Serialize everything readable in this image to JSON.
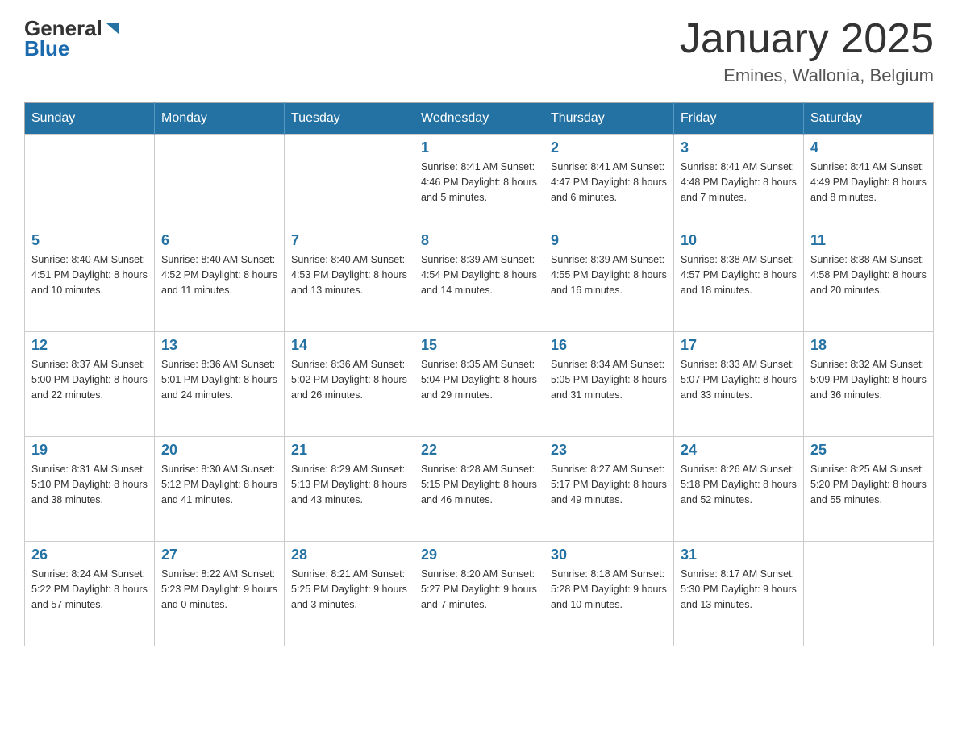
{
  "logo": {
    "general": "General",
    "blue": "Blue"
  },
  "header": {
    "month": "January 2025",
    "location": "Emines, Wallonia, Belgium"
  },
  "weekdays": [
    "Sunday",
    "Monday",
    "Tuesday",
    "Wednesday",
    "Thursday",
    "Friday",
    "Saturday"
  ],
  "weeks": [
    [
      {
        "day": "",
        "info": ""
      },
      {
        "day": "",
        "info": ""
      },
      {
        "day": "",
        "info": ""
      },
      {
        "day": "1",
        "info": "Sunrise: 8:41 AM\nSunset: 4:46 PM\nDaylight: 8 hours\nand 5 minutes."
      },
      {
        "day": "2",
        "info": "Sunrise: 8:41 AM\nSunset: 4:47 PM\nDaylight: 8 hours\nand 6 minutes."
      },
      {
        "day": "3",
        "info": "Sunrise: 8:41 AM\nSunset: 4:48 PM\nDaylight: 8 hours\nand 7 minutes."
      },
      {
        "day": "4",
        "info": "Sunrise: 8:41 AM\nSunset: 4:49 PM\nDaylight: 8 hours\nand 8 minutes."
      }
    ],
    [
      {
        "day": "5",
        "info": "Sunrise: 8:40 AM\nSunset: 4:51 PM\nDaylight: 8 hours\nand 10 minutes."
      },
      {
        "day": "6",
        "info": "Sunrise: 8:40 AM\nSunset: 4:52 PM\nDaylight: 8 hours\nand 11 minutes."
      },
      {
        "day": "7",
        "info": "Sunrise: 8:40 AM\nSunset: 4:53 PM\nDaylight: 8 hours\nand 13 minutes."
      },
      {
        "day": "8",
        "info": "Sunrise: 8:39 AM\nSunset: 4:54 PM\nDaylight: 8 hours\nand 14 minutes."
      },
      {
        "day": "9",
        "info": "Sunrise: 8:39 AM\nSunset: 4:55 PM\nDaylight: 8 hours\nand 16 minutes."
      },
      {
        "day": "10",
        "info": "Sunrise: 8:38 AM\nSunset: 4:57 PM\nDaylight: 8 hours\nand 18 minutes."
      },
      {
        "day": "11",
        "info": "Sunrise: 8:38 AM\nSunset: 4:58 PM\nDaylight: 8 hours\nand 20 minutes."
      }
    ],
    [
      {
        "day": "12",
        "info": "Sunrise: 8:37 AM\nSunset: 5:00 PM\nDaylight: 8 hours\nand 22 minutes."
      },
      {
        "day": "13",
        "info": "Sunrise: 8:36 AM\nSunset: 5:01 PM\nDaylight: 8 hours\nand 24 minutes."
      },
      {
        "day": "14",
        "info": "Sunrise: 8:36 AM\nSunset: 5:02 PM\nDaylight: 8 hours\nand 26 minutes."
      },
      {
        "day": "15",
        "info": "Sunrise: 8:35 AM\nSunset: 5:04 PM\nDaylight: 8 hours\nand 29 minutes."
      },
      {
        "day": "16",
        "info": "Sunrise: 8:34 AM\nSunset: 5:05 PM\nDaylight: 8 hours\nand 31 minutes."
      },
      {
        "day": "17",
        "info": "Sunrise: 8:33 AM\nSunset: 5:07 PM\nDaylight: 8 hours\nand 33 minutes."
      },
      {
        "day": "18",
        "info": "Sunrise: 8:32 AM\nSunset: 5:09 PM\nDaylight: 8 hours\nand 36 minutes."
      }
    ],
    [
      {
        "day": "19",
        "info": "Sunrise: 8:31 AM\nSunset: 5:10 PM\nDaylight: 8 hours\nand 38 minutes."
      },
      {
        "day": "20",
        "info": "Sunrise: 8:30 AM\nSunset: 5:12 PM\nDaylight: 8 hours\nand 41 minutes."
      },
      {
        "day": "21",
        "info": "Sunrise: 8:29 AM\nSunset: 5:13 PM\nDaylight: 8 hours\nand 43 minutes."
      },
      {
        "day": "22",
        "info": "Sunrise: 8:28 AM\nSunset: 5:15 PM\nDaylight: 8 hours\nand 46 minutes."
      },
      {
        "day": "23",
        "info": "Sunrise: 8:27 AM\nSunset: 5:17 PM\nDaylight: 8 hours\nand 49 minutes."
      },
      {
        "day": "24",
        "info": "Sunrise: 8:26 AM\nSunset: 5:18 PM\nDaylight: 8 hours\nand 52 minutes."
      },
      {
        "day": "25",
        "info": "Sunrise: 8:25 AM\nSunset: 5:20 PM\nDaylight: 8 hours\nand 55 minutes."
      }
    ],
    [
      {
        "day": "26",
        "info": "Sunrise: 8:24 AM\nSunset: 5:22 PM\nDaylight: 8 hours\nand 57 minutes."
      },
      {
        "day": "27",
        "info": "Sunrise: 8:22 AM\nSunset: 5:23 PM\nDaylight: 9 hours\nand 0 minutes."
      },
      {
        "day": "28",
        "info": "Sunrise: 8:21 AM\nSunset: 5:25 PM\nDaylight: 9 hours\nand 3 minutes."
      },
      {
        "day": "29",
        "info": "Sunrise: 8:20 AM\nSunset: 5:27 PM\nDaylight: 9 hours\nand 7 minutes."
      },
      {
        "day": "30",
        "info": "Sunrise: 8:18 AM\nSunset: 5:28 PM\nDaylight: 9 hours\nand 10 minutes."
      },
      {
        "day": "31",
        "info": "Sunrise: 8:17 AM\nSunset: 5:30 PM\nDaylight: 9 hours\nand 13 minutes."
      },
      {
        "day": "",
        "info": ""
      }
    ]
  ]
}
